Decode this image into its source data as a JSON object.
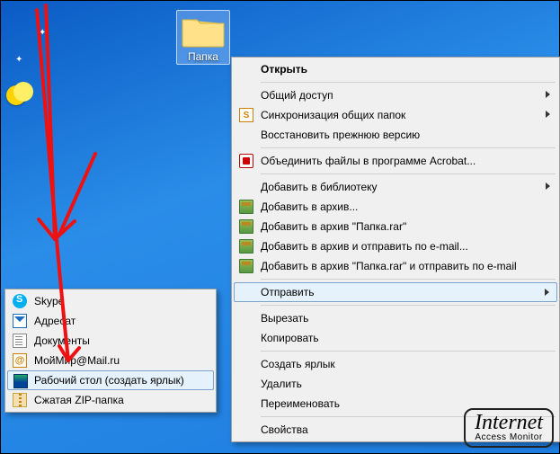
{
  "desktop": {
    "folder": {
      "label": "Папка"
    }
  },
  "context_menu": {
    "open": "Открыть",
    "public_access": "Общий доступ",
    "sync_shared": "Синхронизация общих папок",
    "restore_prev": "Восстановить прежнюю версию",
    "combine_acrobat": "Объединить файлы в программе Acrobat...",
    "add_to_library": "Добавить в библиотеку",
    "add_to_archive": "Добавить в архив...",
    "add_to_archive_name": "Добавить в архив \"Папка.rar\"",
    "add_and_email": "Добавить в архив и отправить по e-mail...",
    "add_name_and_email": "Добавить в архив \"Папка.rar\" и отправить по e-mail",
    "send_to": "Отправить",
    "cut": "Вырезать",
    "copy": "Копировать",
    "create_shortcut": "Создать ярлык",
    "delete": "Удалить",
    "rename": "Переименовать",
    "properties": "Свойства"
  },
  "send_submenu": {
    "skype": "Skype",
    "addressee": "Адресат",
    "documents": "Документы",
    "moimir": "МойМир@Mail.ru",
    "desktop_shortcut": "Рабочий стол (создать ярлык)",
    "zip_folder": "Сжатая ZIP-папка"
  },
  "watermark": {
    "line1": "Internet",
    "line2": "Access Monitor"
  }
}
